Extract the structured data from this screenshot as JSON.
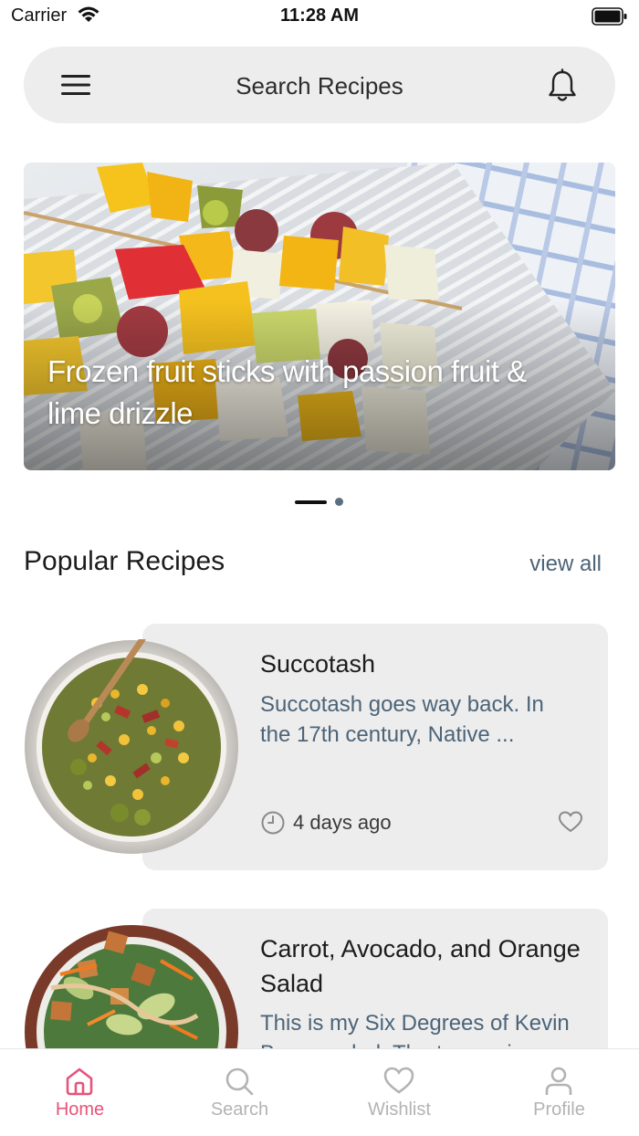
{
  "status_bar": {
    "carrier": "Carrier",
    "time": "11:28 AM"
  },
  "header": {
    "search_title": "Search Recipes",
    "menu_icon": "hamburger-menu-icon",
    "notification_icon": "bell-icon"
  },
  "carousel": {
    "slides": [
      {
        "title": "Frozen fruit sticks with passion fruit & lime drizzle"
      }
    ],
    "active_index": 0,
    "slide_count": 2
  },
  "popular": {
    "title": "Popular Recipes",
    "view_all_label": "view all",
    "recipes": [
      {
        "title": "Succotash",
        "description": "Succotash goes way back. In the 17th century, Native ...",
        "time_ago": "4 days ago"
      },
      {
        "title": "Carrot, Avocado, and Orange Salad",
        "description": "This is my Six Degrees of Kevin Bacon salad. The two main"
      }
    ]
  },
  "tab_bar": {
    "tabs": [
      {
        "label": "Home",
        "icon": "home-icon",
        "active": true
      },
      {
        "label": "Search",
        "icon": "search-icon",
        "active": false
      },
      {
        "label": "Wishlist",
        "icon": "heart-icon",
        "active": false
      },
      {
        "label": "Profile",
        "icon": "person-icon",
        "active": false
      }
    ]
  },
  "colors": {
    "accent": "#e8537a",
    "muted_blue": "#4c6478",
    "card_bg": "#ededed",
    "inactive_tab": "#b3b3b3"
  }
}
